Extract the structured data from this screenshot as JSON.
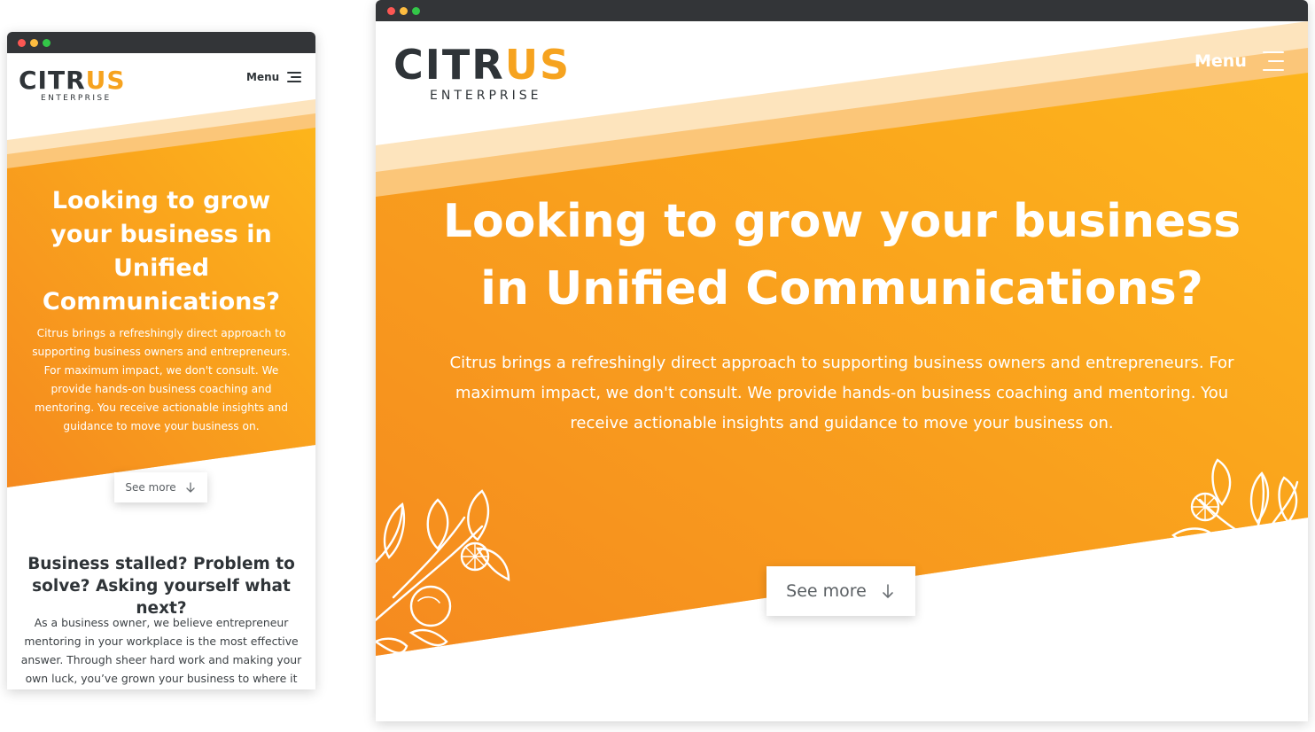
{
  "brand": {
    "logo_primary": "CITR",
    "logo_accent": "US",
    "logo_sub": "ENTERPRISE",
    "colors": {
      "dark": "#2f3438",
      "orange": "#f6a31f",
      "hero_orange_start": "#f58a1f",
      "hero_orange_end": "#fdb51b"
    }
  },
  "nav": {
    "menu_label": "Menu",
    "menu_icon": "hamburger-icon"
  },
  "hero": {
    "title": "Looking to grow your business in Unified Communications?",
    "body": "Citrus brings a refreshingly direct approach to supporting business owners and entrepreneurs. For maximum impact, we don't consult. We provide hands-on business coaching and mentoring. You receive actionable insights and guidance to move your business on.",
    "cta_label": "See more",
    "cta_icon": "arrow-down-icon",
    "decoration_icon": "citrus-branch-illustration"
  },
  "section": {
    "title": "Business stalled? Problem to solve? Asking yourself what next?",
    "body": "As a business owner, we believe entrepreneur mentoring in your workplace is the most effective answer. Through sheer hard work and making your own luck, you’ve grown your business to where it is today. You won't be alone in thinking what next?"
  }
}
